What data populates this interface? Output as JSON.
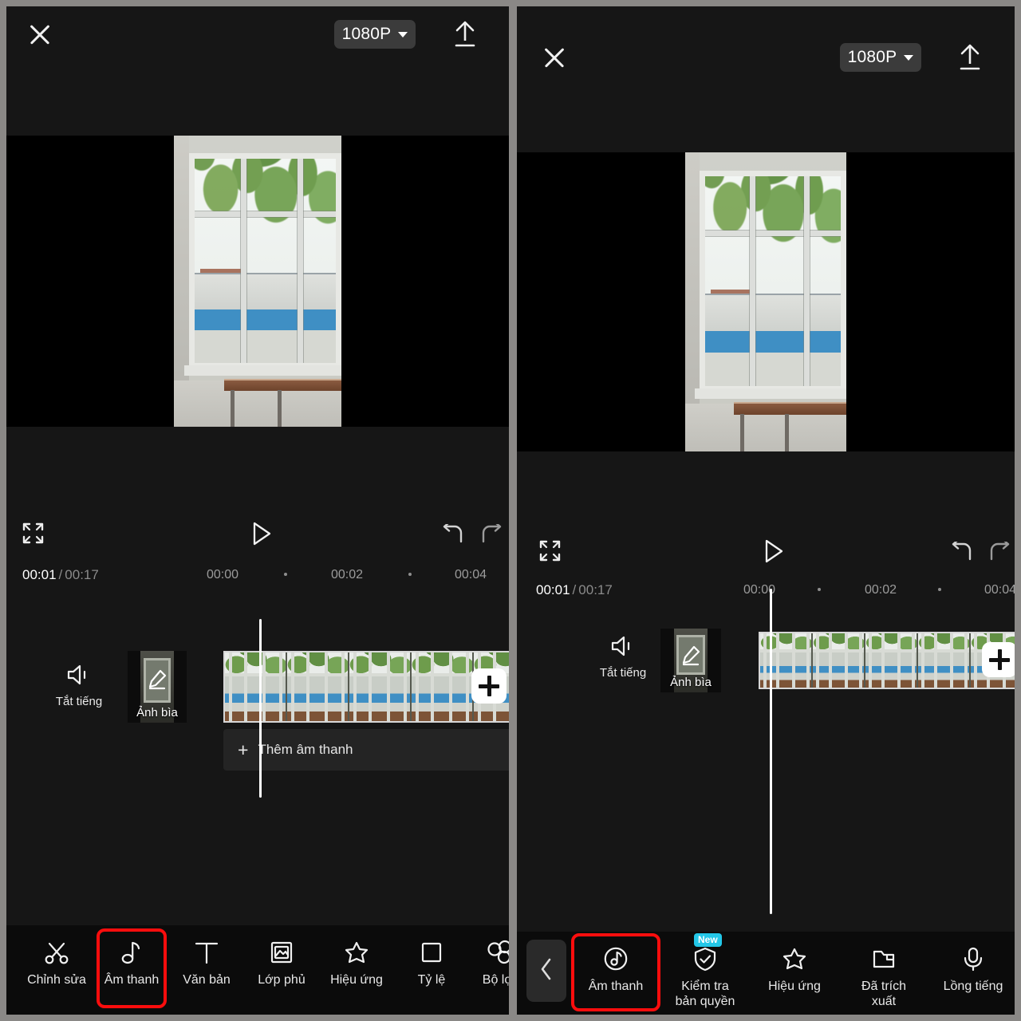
{
  "app": {
    "accent_red": "#fb0d0d",
    "badge_blue": "#23c7e8",
    "panel_bg": "#161616",
    "toolbar_bg": "#0b0b0b",
    "gutter": "#8a8886"
  },
  "left_panel": {
    "header": {
      "close_icon": "close-icon",
      "resolution": "1080P",
      "resolution_caret": "chevron-down-icon",
      "export_icon": "export-upload-icon"
    },
    "controls": {
      "fullscreen_icon": "expand-icon",
      "play_icon": "play-icon",
      "undo_icon": "undo-icon",
      "redo_icon": "redo-icon"
    },
    "ruler": {
      "current_time": "00:01",
      "separator": "/",
      "total_time": "00:17",
      "ticks": [
        "00:00",
        "00:02",
        "00:04"
      ]
    },
    "timeline": {
      "mute_label": "Tắt tiếng",
      "mute_icon": "speaker-mute-icon",
      "cover_label": "Ảnh bìa",
      "cover_icon": "pencil-edit-icon",
      "add_clip_icon": "plus-icon",
      "add_audio_label": "Thêm âm thanh",
      "add_audio_icon": "plus-icon",
      "frame_count": 5
    },
    "toolbar": [
      {
        "label": "Chỉnh sửa",
        "icon": "scissors-icon",
        "highlighted": false
      },
      {
        "label": "Âm thanh",
        "icon": "music-note-icon",
        "highlighted": true
      },
      {
        "label": "Văn bản",
        "icon": "text-t-icon",
        "highlighted": false
      },
      {
        "label": "Lớp phủ",
        "icon": "picture-overlay-icon",
        "highlighted": false
      },
      {
        "label": "Hiệu ứng",
        "icon": "sparkle-star-icon",
        "highlighted": false
      },
      {
        "label": "Tỷ lệ",
        "icon": "square-ratio-icon",
        "highlighted": false
      },
      {
        "label": "Bộ lọc",
        "icon": "filter-circles-icon",
        "highlighted": false
      }
    ]
  },
  "right_panel": {
    "header": {
      "close_icon": "close-icon",
      "resolution": "1080P",
      "resolution_caret": "chevron-down-icon",
      "export_icon": "export-upload-icon"
    },
    "controls": {
      "fullscreen_icon": "expand-icon",
      "play_icon": "play-icon",
      "undo_icon": "undo-icon",
      "redo_icon": "redo-icon"
    },
    "ruler": {
      "current_time": "00:01",
      "separator": "/",
      "total_time": "00:17",
      "ticks": [
        "00:00",
        "00:02",
        "00:04"
      ]
    },
    "timeline": {
      "mute_label": "Tắt tiếng",
      "mute_icon": "speaker-mute-icon",
      "cover_label": "Ảnh bìa",
      "cover_icon": "pencil-edit-icon",
      "add_clip_icon": "plus-icon",
      "frame_count": 5
    },
    "toolbar": {
      "back_icon": "chevron-left-icon",
      "items": [
        {
          "label": "Âm thanh",
          "icon": "music-disc-icon",
          "highlighted": true,
          "badge": ""
        },
        {
          "label": "Kiểm tra\nbản quyền",
          "icon": "shield-check-icon",
          "highlighted": false,
          "badge": "New"
        },
        {
          "label": "Hiệu ứng",
          "icon": "sparkle-star-icon",
          "highlighted": false,
          "badge": ""
        },
        {
          "label": "Đã trích\nxuất",
          "icon": "folder-icon",
          "highlighted": false,
          "badge": ""
        },
        {
          "label": "Lồng tiếng",
          "icon": "microphone-icon",
          "highlighted": false,
          "badge": ""
        }
      ]
    }
  }
}
